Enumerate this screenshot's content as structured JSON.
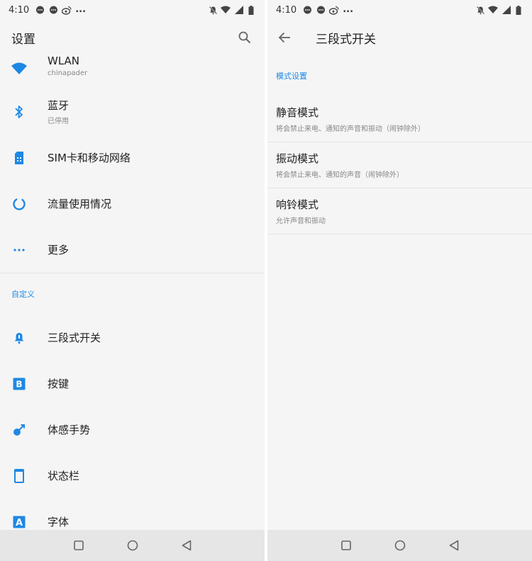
{
  "status": {
    "time": "4:10",
    "overflow": "..."
  },
  "left": {
    "title": "设置",
    "items_top": [
      {
        "label": "WLAN",
        "sub": "chinapader",
        "icon": "wifi-icon"
      },
      {
        "label": "蓝牙",
        "sub": "已停用",
        "icon": "bluetooth-icon"
      },
      {
        "label": "SIM卡和移动网络",
        "sub": "",
        "icon": "sim-card-icon"
      },
      {
        "label": "流量使用情况",
        "sub": "",
        "icon": "data-usage-icon"
      },
      {
        "label": "更多",
        "sub": "",
        "icon": "more-dots-icon"
      }
    ],
    "section_custom": "自定义",
    "items_custom": [
      {
        "label": "三段式开关",
        "icon": "bell-icon"
      },
      {
        "label": "按键",
        "icon": "button-b-icon"
      },
      {
        "label": "体感手势",
        "icon": "gesture-icon"
      },
      {
        "label": "状态栏",
        "icon": "phone-frame-icon"
      },
      {
        "label": "字体",
        "icon": "font-a-icon"
      }
    ]
  },
  "right": {
    "title": "三段式开关",
    "section": "模式设置",
    "items": [
      {
        "label": "静音模式",
        "sub": "将会禁止来电、通知的声音和振动（闹钟除外）"
      },
      {
        "label": "振动模式",
        "sub": "将会禁止来电、通知的声音（闹钟除外）"
      },
      {
        "label": "响铃模式",
        "sub": "允许声音和振动"
      }
    ]
  },
  "colors": {
    "accent": "#1e88e5",
    "background": "#f5f5f5",
    "navbar": "#e6e6e6"
  }
}
